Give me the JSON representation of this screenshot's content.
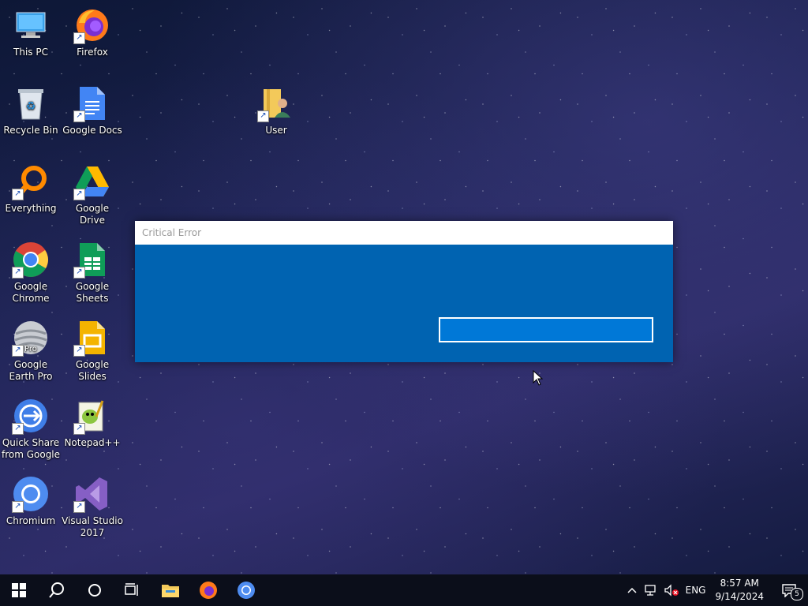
{
  "desktop": {
    "icons": [
      {
        "label": "This PC"
      },
      {
        "label": "Firefox"
      },
      {
        "label": "Recycle Bin"
      },
      {
        "label": "Google Docs"
      },
      {
        "label": "User"
      },
      {
        "label": "Everything"
      },
      {
        "label": "Google Drive"
      },
      {
        "label": "Google Chrome"
      },
      {
        "label": "Google Sheets"
      },
      {
        "label": "Google Earth Pro"
      },
      {
        "label": "Google Slides"
      },
      {
        "label": "Quick Share from Google"
      },
      {
        "label": "Notepad++"
      },
      {
        "label": "Chromium"
      },
      {
        "label": "Visual Studio 2017"
      }
    ],
    "earth_badge": "Pro"
  },
  "dialog": {
    "title": "Critical Error",
    "button_label": ""
  },
  "taskbar": {
    "pinned": [
      "start-icon",
      "search-icon",
      "cortana-icon",
      "task-view-icon",
      "file-explorer-icon",
      "firefox-icon",
      "chromium-icon"
    ],
    "tray": {
      "language": "ENG",
      "time": "8:57 AM",
      "date": "9/14/2024",
      "notification_count": "5"
    }
  },
  "colors": {
    "dialog_body": "#0063b1",
    "dialog_button": "#0078d7",
    "taskbar": "#0b0e1a"
  }
}
